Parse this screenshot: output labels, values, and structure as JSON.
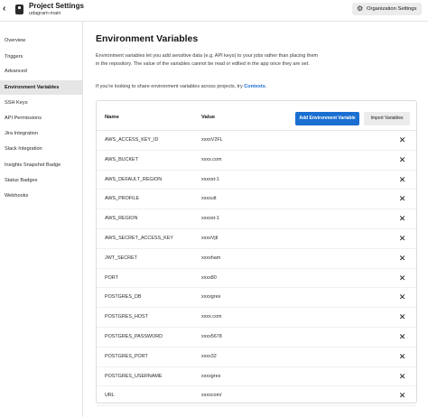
{
  "header": {
    "title": "Project Settings",
    "subtitle": "udagram-main",
    "org_button": "Organization Settings",
    "icons": {
      "back": "chevron-left-icon",
      "project": "project-icon",
      "org": "gear-icon"
    }
  },
  "sidebar": {
    "items": [
      {
        "label": "Overview",
        "active": false
      },
      {
        "label": "Triggers",
        "active": false
      },
      {
        "label": "Advanced",
        "active": false
      },
      {
        "label": "Environment Variables",
        "active": true
      },
      {
        "label": "SSH Keys",
        "active": false
      },
      {
        "label": "API Permissions",
        "active": false
      },
      {
        "label": "Jira Integration",
        "active": false
      },
      {
        "label": "Slack Integration",
        "active": false
      },
      {
        "label": "Insights Snapshot Badge",
        "active": false
      },
      {
        "label": "Status Badges",
        "active": false
      },
      {
        "label": "Webhooks",
        "active": false
      }
    ]
  },
  "main": {
    "heading": "Environment Variables",
    "description": "Environment variables let you add sensitive data (e.g. API keys) to your jobs rather than placing them in the repository. The value of the variables cannot be read or edited in the app once they are set.",
    "share_prefix": "If you're looking to share environment variables across projects, try ",
    "share_link": "Contexts",
    "share_suffix": ".",
    "table": {
      "col_name": "Name",
      "col_value": "Value",
      "add_button": "Add Environment Variable",
      "import_button": "Import Variables",
      "rows": [
        {
          "name": "AWS_ACCESS_KEY_ID",
          "value": "xxxxV2FL"
        },
        {
          "name": "AWS_BUCKET",
          "value": "xxxx.com"
        },
        {
          "name": "AWS_DEFAULT_REGION",
          "value": "xxxxst-1"
        },
        {
          "name": "AWS_PROFILE",
          "value": "xxxxult"
        },
        {
          "name": "AWS_REGION",
          "value": "xxxxst-1"
        },
        {
          "name": "AWS_SECRET_ACCESS_KEY",
          "value": "xxxxVjtl"
        },
        {
          "name": "JWT_SECRET",
          "value": "xxxxham"
        },
        {
          "name": "PORT",
          "value": "xxxx80"
        },
        {
          "name": "POSTGRES_DB",
          "value": "xxxxgres"
        },
        {
          "name": "POSTGRES_HOST",
          "value": "xxxx.com"
        },
        {
          "name": "POSTGRES_PASSWORD",
          "value": "xxxx5678"
        },
        {
          "name": "POSTGRES_PORT",
          "value": "xxxx32"
        },
        {
          "name": "POSTGRES_USERNAME",
          "value": "xxxxgres"
        },
        {
          "name": "URL",
          "value": "xxxxcom/"
        }
      ],
      "delete_icon": "close-icon"
    }
  },
  "colors": {
    "accent": "#1a6fd1",
    "active_bg": "#e6e6e6",
    "button_bg": "#ececec"
  }
}
